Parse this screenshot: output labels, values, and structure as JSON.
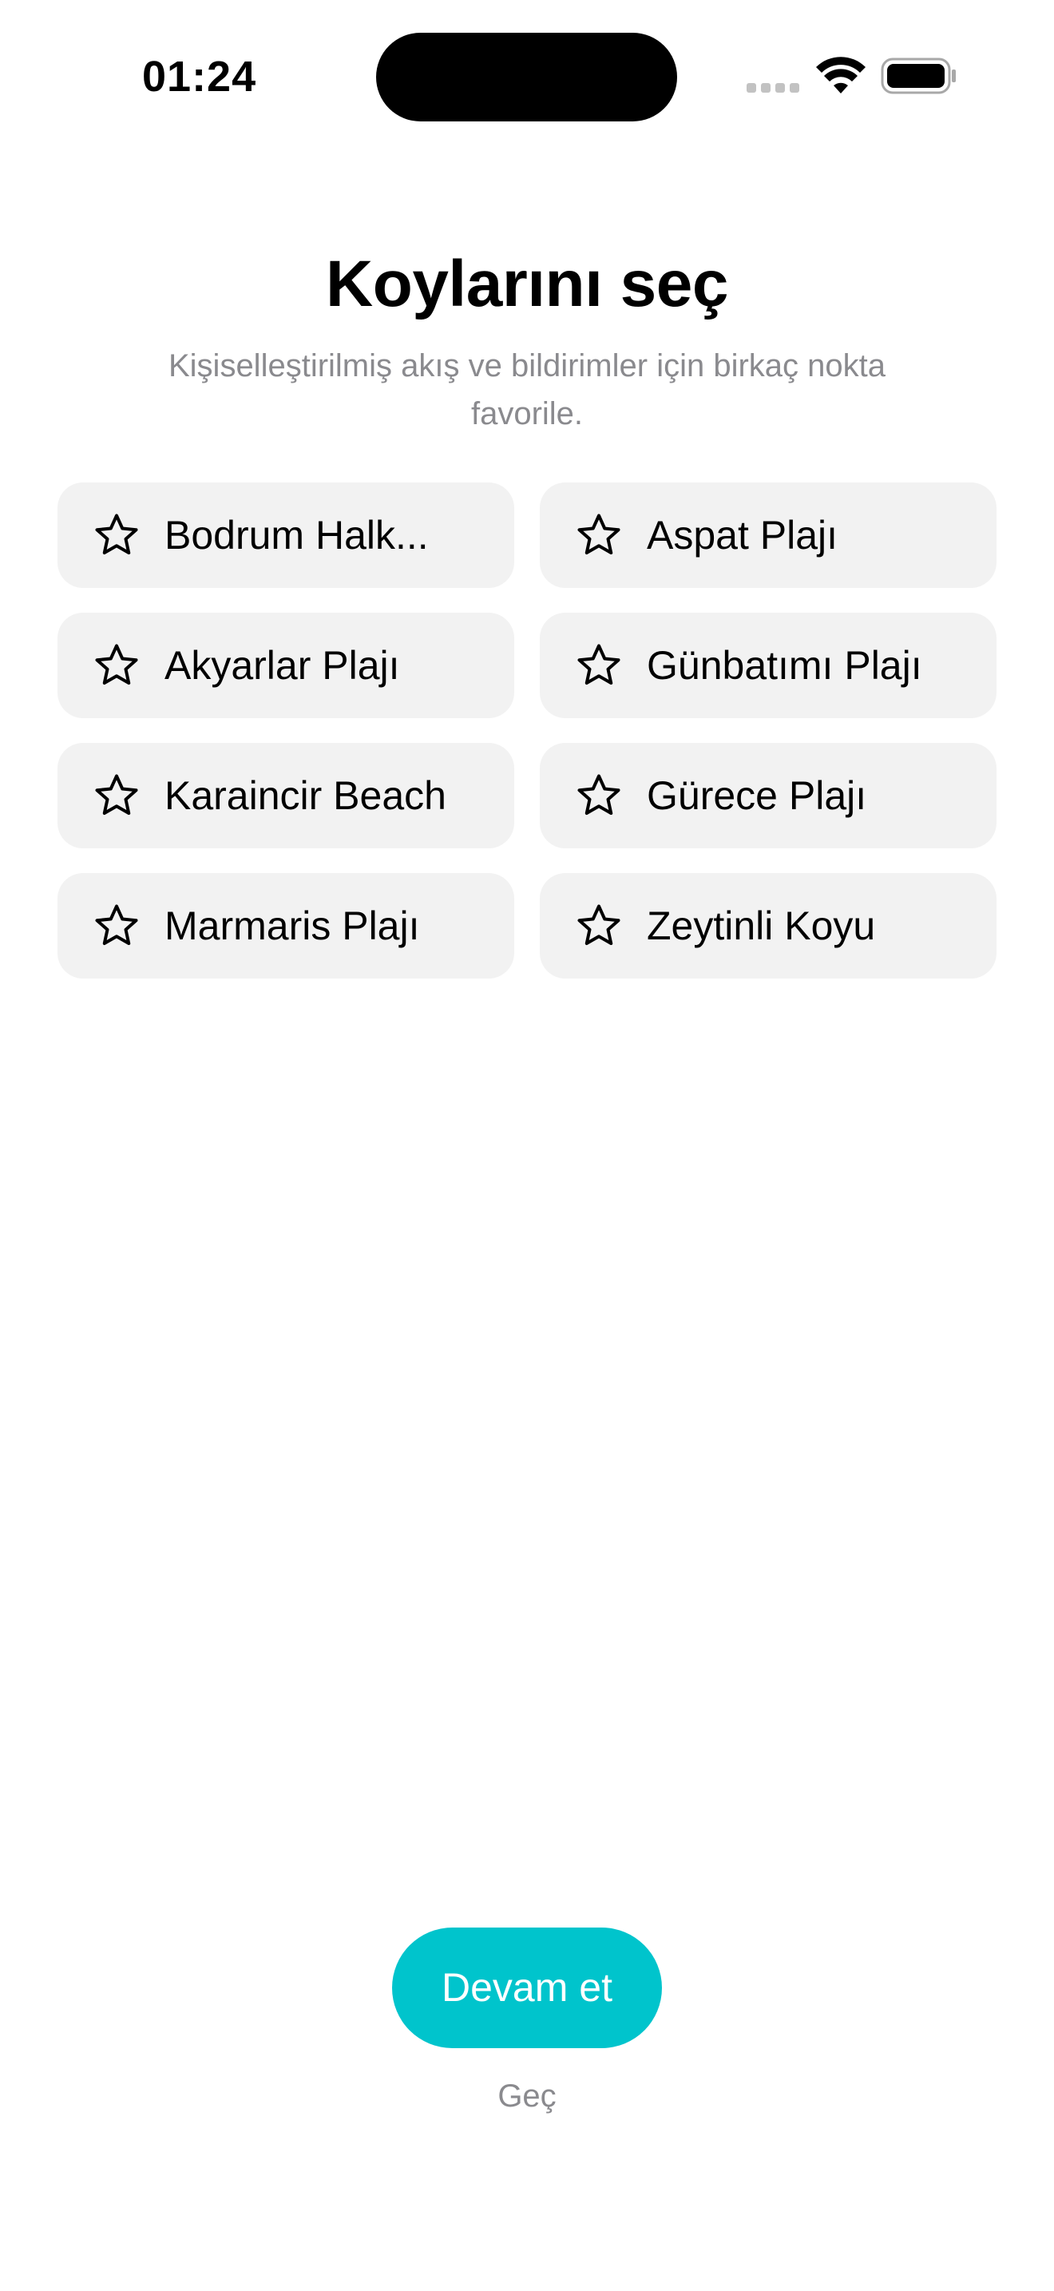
{
  "status_bar": {
    "time": "01:24",
    "signal_icon": "cellular-signal-icon",
    "wifi_icon": "wifi-icon",
    "battery_icon": "battery-icon"
  },
  "header": {
    "title": "Koylarını seç",
    "subtitle": "Kişiselleştirilmiş akış ve bildirimler için birkaç nokta favorile."
  },
  "beaches": [
    {
      "label": "Bodrum Halk...",
      "icon": "star-outline-icon",
      "favorited": false
    },
    {
      "label": "Aspat Plajı",
      "icon": "star-outline-icon",
      "favorited": false
    },
    {
      "label": "Akyarlar Plajı",
      "icon": "star-outline-icon",
      "favorited": false
    },
    {
      "label": "Günbatımı Plajı",
      "icon": "star-outline-icon",
      "favorited": false
    },
    {
      "label": "Karaincir Beach",
      "icon": "star-outline-icon",
      "favorited": false
    },
    {
      "label": "Gürece Plajı",
      "icon": "star-outline-icon",
      "favorited": false
    },
    {
      "label": "Marmaris Plajı",
      "icon": "star-outline-icon",
      "favorited": false
    },
    {
      "label": "Zeytinli Koyu",
      "icon": "star-outline-icon",
      "favorited": false
    }
  ],
  "footer": {
    "continue_label": "Devam et",
    "skip_label": "Geç"
  },
  "colors": {
    "accent": "#00c4cc",
    "chip_background": "#f2f2f2",
    "secondary_text": "#8a8a8e"
  }
}
